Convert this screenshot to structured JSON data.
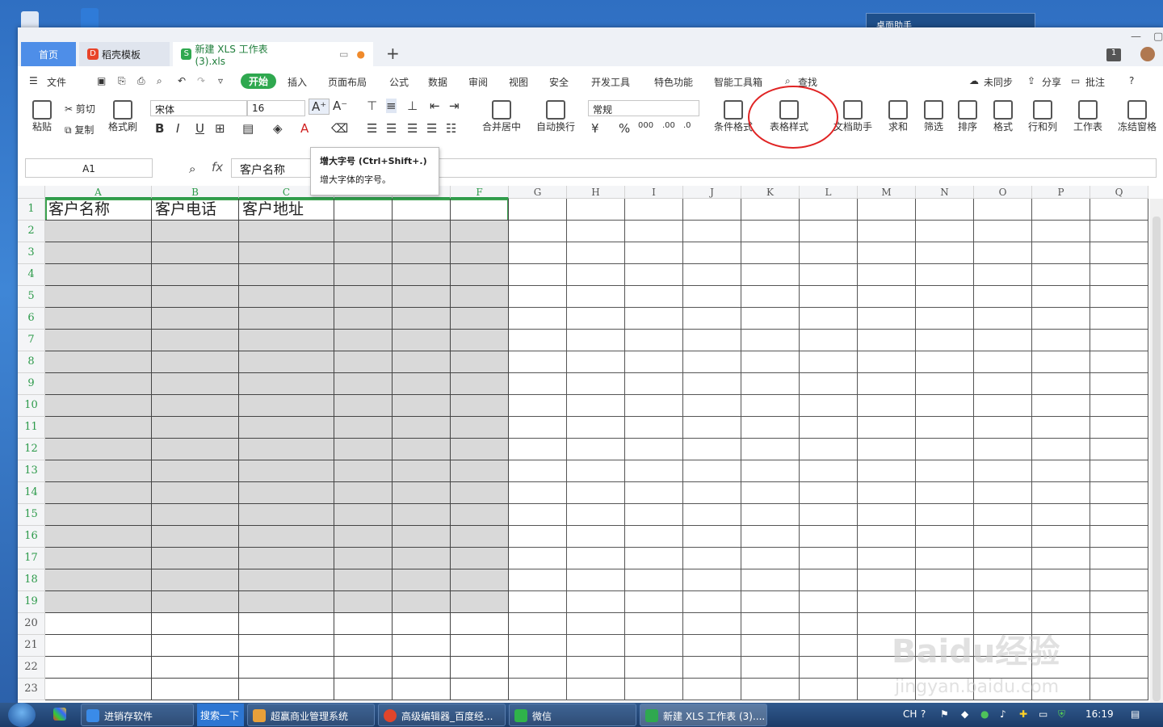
{
  "desktop": {
    "assistant_label": "桌面助手"
  },
  "tabs": {
    "home": "首页",
    "template": "稻壳模板",
    "doc": "新建 XLS 工作表 (3).xls"
  },
  "window": {
    "badge": "1"
  },
  "menu": {
    "file": "文件",
    "start": "开始",
    "insert": "插入",
    "layout": "页面布局",
    "formula": "公式",
    "data": "数据",
    "review": "审阅",
    "view": "视图",
    "security": "安全",
    "dev": "开发工具",
    "special": "特色功能",
    "smart": "智能工具箱",
    "find": "查找",
    "sync": "未同步",
    "share": "分享",
    "comment": "批注",
    "help": "?"
  },
  "ribbon": {
    "paste": "粘贴",
    "cut": "剪切",
    "copy": "复制",
    "format_painter": "格式刷",
    "font": "宋体",
    "font_size": "16",
    "merge": "合并居中",
    "wrap": "自动换行",
    "number_format": "常规",
    "cond_format": "条件格式",
    "table_style": "表格样式",
    "doc_helper": "文档助手",
    "sum": "求和",
    "filter": "筛选",
    "sort": "排序",
    "format": "格式",
    "rowcol": "行和列",
    "sheet": "工作表",
    "freeze": "冻结窗格"
  },
  "tooltip": {
    "title": "增大字号 (Ctrl+Shift+.)",
    "desc": "增大字体的字号。"
  },
  "formula_bar": {
    "name_box": "A1",
    "fx": "fx",
    "content": "客户名称"
  },
  "sheet": {
    "columns": [
      "A",
      "B",
      "C",
      "D",
      "E",
      "F",
      "G",
      "H",
      "I",
      "J",
      "K",
      "L",
      "M",
      "N",
      "O",
      "P",
      "Q"
    ],
    "rows": [
      "1",
      "2",
      "3",
      "4",
      "5",
      "6",
      "7",
      "8",
      "9",
      "10",
      "11",
      "12",
      "13",
      "14",
      "15",
      "16",
      "17",
      "18",
      "19",
      "20",
      "21",
      "22",
      "23"
    ],
    "header_cells": [
      "客户名称",
      "客户电话",
      "客户地址",
      "",
      "",
      ""
    ]
  },
  "taskbar": {
    "jxc": "进销存软件",
    "search": "搜索一下",
    "cy": "超赢商业管理系统",
    "editor": "高级编辑器_百度经...",
    "wechat": "微信",
    "xls": "新建 XLS 工作表 (3)....",
    "lang": "CH",
    "time": "16:19"
  },
  "watermark": {
    "brand": "Baidu经验",
    "url": "jingyan.baidu.com"
  }
}
